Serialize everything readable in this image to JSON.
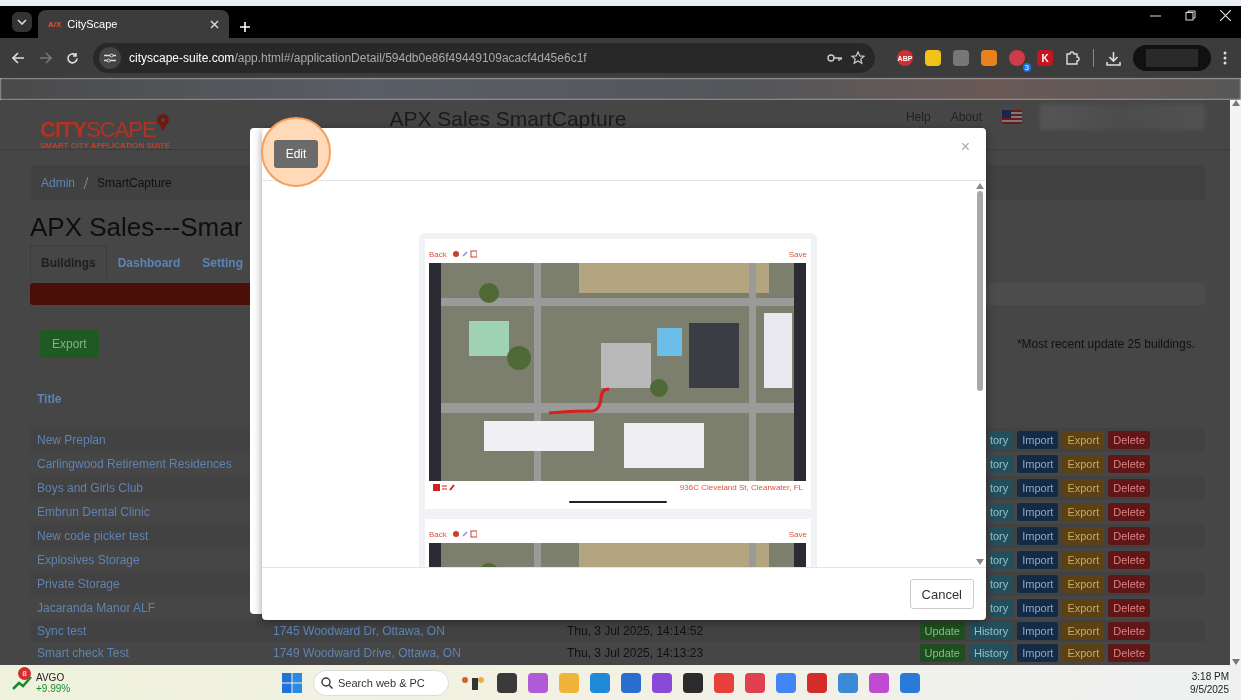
{
  "browser": {
    "tab": {
      "favicon": "A/X",
      "title": "CityScape"
    },
    "url": {
      "host": "cityscape-suite.com",
      "path": "/app.html#/applicationDetail/594db0e86f49449109acacf4d45e6c1f"
    },
    "extensions": [
      {
        "kind": "abp",
        "label": "ABP"
      },
      {
        "kind": "bulb"
      },
      {
        "kind": "copy"
      },
      {
        "kind": "hub"
      },
      {
        "kind": "badge",
        "badge": "3"
      },
      {
        "kind": "k",
        "label": "K"
      }
    ]
  },
  "header": {
    "logo": {
      "name": "**CITY**SCAPE",
      "tagline": "SMART CITY APPLICATION SUITE"
    },
    "title": "APX Sales SmartCapture",
    "links": [
      "Help",
      "About"
    ]
  },
  "breadcrumb": [
    "Admin",
    "SmartCapture"
  ],
  "page_title": "APX Sales---Smar",
  "tabs": [
    {
      "label": "Buildings",
      "selected": true
    },
    {
      "label": "Dashboard",
      "selected": false
    },
    {
      "label": "Setting",
      "selected": false
    }
  ],
  "export_button": "Export",
  "note": "*Most recent update 25 buildings.",
  "table": {
    "columns": [
      "Title"
    ],
    "rows": [
      {
        "title": "New Preplan",
        "actions": [
          {
            "kind": "history",
            "label": "tory"
          },
          {
            "kind": "import",
            "label": "Import"
          },
          {
            "kind": "export",
            "label": "Export"
          },
          {
            "kind": "delete",
            "label": "Delete"
          }
        ]
      },
      {
        "title": "Carlingwood Retirement Residences",
        "actions": [
          {
            "kind": "history",
            "label": "tory"
          },
          {
            "kind": "import",
            "label": "Import"
          },
          {
            "kind": "export",
            "label": "Export"
          },
          {
            "kind": "delete",
            "label": "Delete"
          }
        ]
      },
      {
        "title": "Boys and Girls Club",
        "actions": [
          {
            "kind": "history",
            "label": "tory"
          },
          {
            "kind": "import",
            "label": "Import"
          },
          {
            "kind": "export",
            "label": "Export"
          },
          {
            "kind": "delete",
            "label": "Delete"
          }
        ]
      },
      {
        "title": "Embrun Dental Clinic",
        "actions": [
          {
            "kind": "history",
            "label": "tory"
          },
          {
            "kind": "import",
            "label": "Import"
          },
          {
            "kind": "export",
            "label": "Export"
          },
          {
            "kind": "delete",
            "label": "Delete"
          }
        ]
      },
      {
        "title": "New code picker test",
        "actions": [
          {
            "kind": "history",
            "label": "tory"
          },
          {
            "kind": "import",
            "label": "Import"
          },
          {
            "kind": "export",
            "label": "Export"
          },
          {
            "kind": "delete",
            "label": "Delete"
          }
        ]
      },
      {
        "title": "Explosives Storage",
        "actions": [
          {
            "kind": "history",
            "label": "tory"
          },
          {
            "kind": "import",
            "label": "Import"
          },
          {
            "kind": "export",
            "label": "Export"
          },
          {
            "kind": "delete",
            "label": "Delete"
          }
        ]
      },
      {
        "title": "Private Storage",
        "actions": [
          {
            "kind": "history",
            "label": "tory"
          },
          {
            "kind": "import",
            "label": "Import"
          },
          {
            "kind": "export",
            "label": "Export"
          },
          {
            "kind": "delete",
            "label": "Delete"
          }
        ]
      },
      {
        "title": "Jacaranda Manor ALF",
        "actions": [
          {
            "kind": "history",
            "label": "tory"
          },
          {
            "kind": "import",
            "label": "Import"
          },
          {
            "kind": "export",
            "label": "Export"
          },
          {
            "kind": "delete",
            "label": "Delete"
          }
        ]
      },
      {
        "title": "Sync test",
        "address": "1745 Woodward Dr, Ottawa, ON",
        "date": "Thu, 3 Jul 2025, 14:14:52",
        "actions": [
          {
            "kind": "update",
            "label": "Update"
          },
          {
            "kind": "history",
            "label": "History"
          },
          {
            "kind": "import",
            "label": "Import"
          },
          {
            "kind": "export",
            "label": "Export"
          },
          {
            "kind": "delete",
            "label": "Delete"
          }
        ]
      },
      {
        "title": "Smart check Test",
        "address": "1749 Woodward Drive, Ottawa, ON",
        "date": "Thu, 3 Jul 2025, 14:13:23",
        "actions": [
          {
            "kind": "update",
            "label": "Update"
          },
          {
            "kind": "history",
            "label": "History"
          },
          {
            "kind": "import",
            "label": "Import"
          },
          {
            "kind": "export",
            "label": "Export"
          },
          {
            "kind": "delete",
            "label": "Delete"
          }
        ]
      }
    ]
  },
  "modal": {
    "edit_button": "Edit",
    "close": "×",
    "screens": [
      {
        "back": "Back",
        "save": "Save",
        "address": "936C Cleveland St, Clearwater, FL"
      },
      {
        "back": "Back",
        "save": "Save"
      }
    ],
    "cancel": "Cancel"
  },
  "taskbar": {
    "stock": {
      "badge": "8",
      "symbol": "AVGO",
      "change": "+9.99%"
    },
    "search_placeholder": "Search web & PC",
    "apps": [
      {
        "color": "#3a3a3a"
      },
      {
        "color": "#b05ad8"
      },
      {
        "color": "#f0b43a"
      },
      {
        "color": "#1f8ad8"
      },
      {
        "color": "#2a6fd0"
      },
      {
        "color": "#8a4ad8"
      },
      {
        "color": "#2b2b2b"
      },
      {
        "color": "#e8413c"
      },
      {
        "color": "#e0414f"
      },
      {
        "color": "#4285f4"
      },
      {
        "color": "#d42b2b"
      },
      {
        "color": "#3a8ad8"
      },
      {
        "color": "#c04ad0"
      },
      {
        "color": "#2a7ad8"
      }
    ],
    "time": "3:18 PM",
    "date": "9/5/2025"
  }
}
